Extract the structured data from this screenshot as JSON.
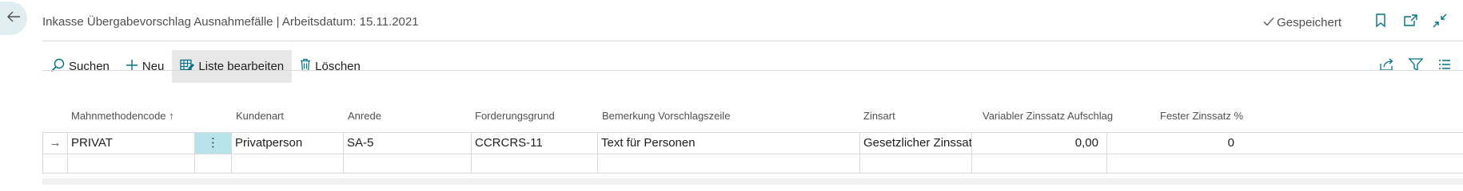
{
  "header": {
    "title": "Inkasse Übergabevorschlag Ausnahmefälle | Arbeitsdatum: 15.11.2021",
    "saved_status": "Gespeichert"
  },
  "actions": {
    "search": "Suchen",
    "new": "Neu",
    "edit_list": "Liste bearbeiten",
    "delete": "Löschen"
  },
  "columns": {
    "mahnmethodencode": "Mahnmethodencode",
    "sort_indicator": "↑",
    "kundenart": "Kundenart",
    "anrede": "Anrede",
    "forderungsgrund": "Forderungsgrund",
    "bemerkung": "Bemerkung Vorschlagszeile",
    "zinsart": "Zinsart",
    "variabler_zinssatz": "Variabler Zinssatz Aufschlag",
    "fester_zinssatz": "Fester Zinssatz %"
  },
  "rows": [
    {
      "indicator": "→",
      "mahnmethodencode": "PRIVAT",
      "menu": "⋮",
      "kundenart": "Privatperson",
      "anrede": "SA-5",
      "forderungsgrund": "CCRCRS-11",
      "bemerkung": "Text für Personen",
      "zinsart": "Gesetzlicher Zinssatz",
      "variabler_zinssatz": "0,00",
      "fester_zinssatz": "0"
    }
  ],
  "colors": {
    "accent": "#00718a",
    "selected_cell": "#b8e3ec",
    "back_button_bg": "#e0eef2"
  }
}
